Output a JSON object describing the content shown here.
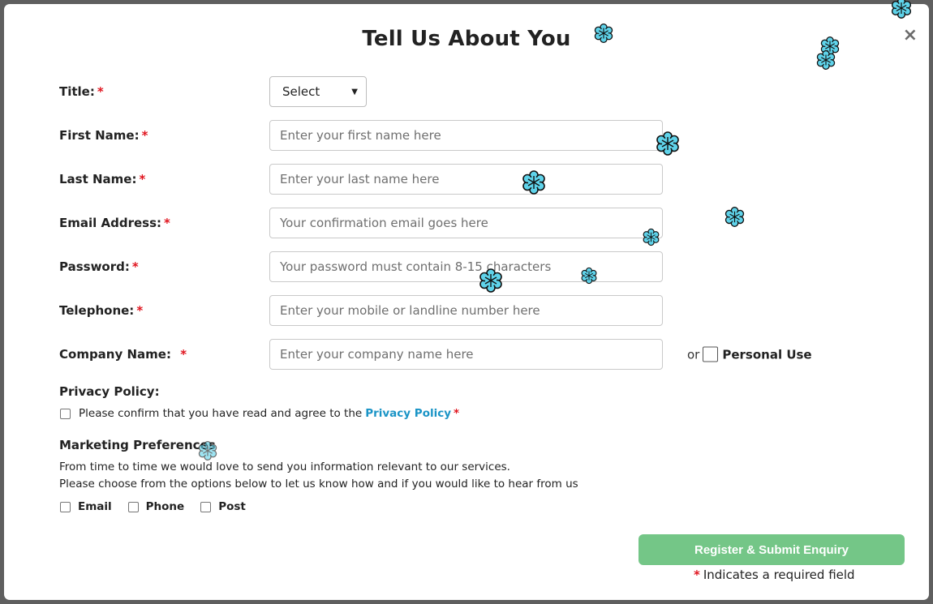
{
  "modal": {
    "title": "Tell Us About You",
    "close_label": "×"
  },
  "fields": [
    {
      "key": "title",
      "label": "Title:",
      "required": "*",
      "type": "select",
      "value": "Select"
    },
    {
      "key": "first_name",
      "label": "First Name:",
      "required": "*",
      "placeholder": "Enter your first name here"
    },
    {
      "key": "last_name",
      "label": "Last Name:",
      "required": "*",
      "placeholder": "Enter your last name here"
    },
    {
      "key": "email",
      "label": "Email Address:",
      "required": "*",
      "placeholder": "Your confirmation email goes here"
    },
    {
      "key": "password",
      "label": "Password:",
      "required": "*",
      "placeholder": "Your password must contain 8-15 characters"
    },
    {
      "key": "telephone",
      "label": "Telephone:",
      "required": "*",
      "placeholder": "Enter your mobile or landline number here"
    },
    {
      "key": "company",
      "label": "Company Name:",
      "required": "*",
      "placeholder": "Enter your company name here"
    }
  ],
  "personal_use": {
    "or_text": "or",
    "label": "Personal Use"
  },
  "privacy": {
    "heading": "Privacy Policy:",
    "text": "Please confirm that you have read and agree to the",
    "link": "Privacy Policy",
    "required": "*"
  },
  "marketing": {
    "heading": "Marketing Preferences",
    "line1": "From time to time we would love to send you information relevant to our services.",
    "line2": "Please choose from the options below to let us know how and if you would like to hear from us",
    "options": [
      "Email",
      "Phone",
      "Post"
    ]
  },
  "submit_label": "Register & Submit Enquiry",
  "required_note": {
    "star": "*",
    "text": "Indicates a required field"
  },
  "colors": {
    "accent_link": "#1a94c6",
    "required": "#e0141e",
    "submit": "#74c687",
    "flake": "#5fd3ea"
  },
  "decor": {
    "icon": "snowflake-icon"
  }
}
